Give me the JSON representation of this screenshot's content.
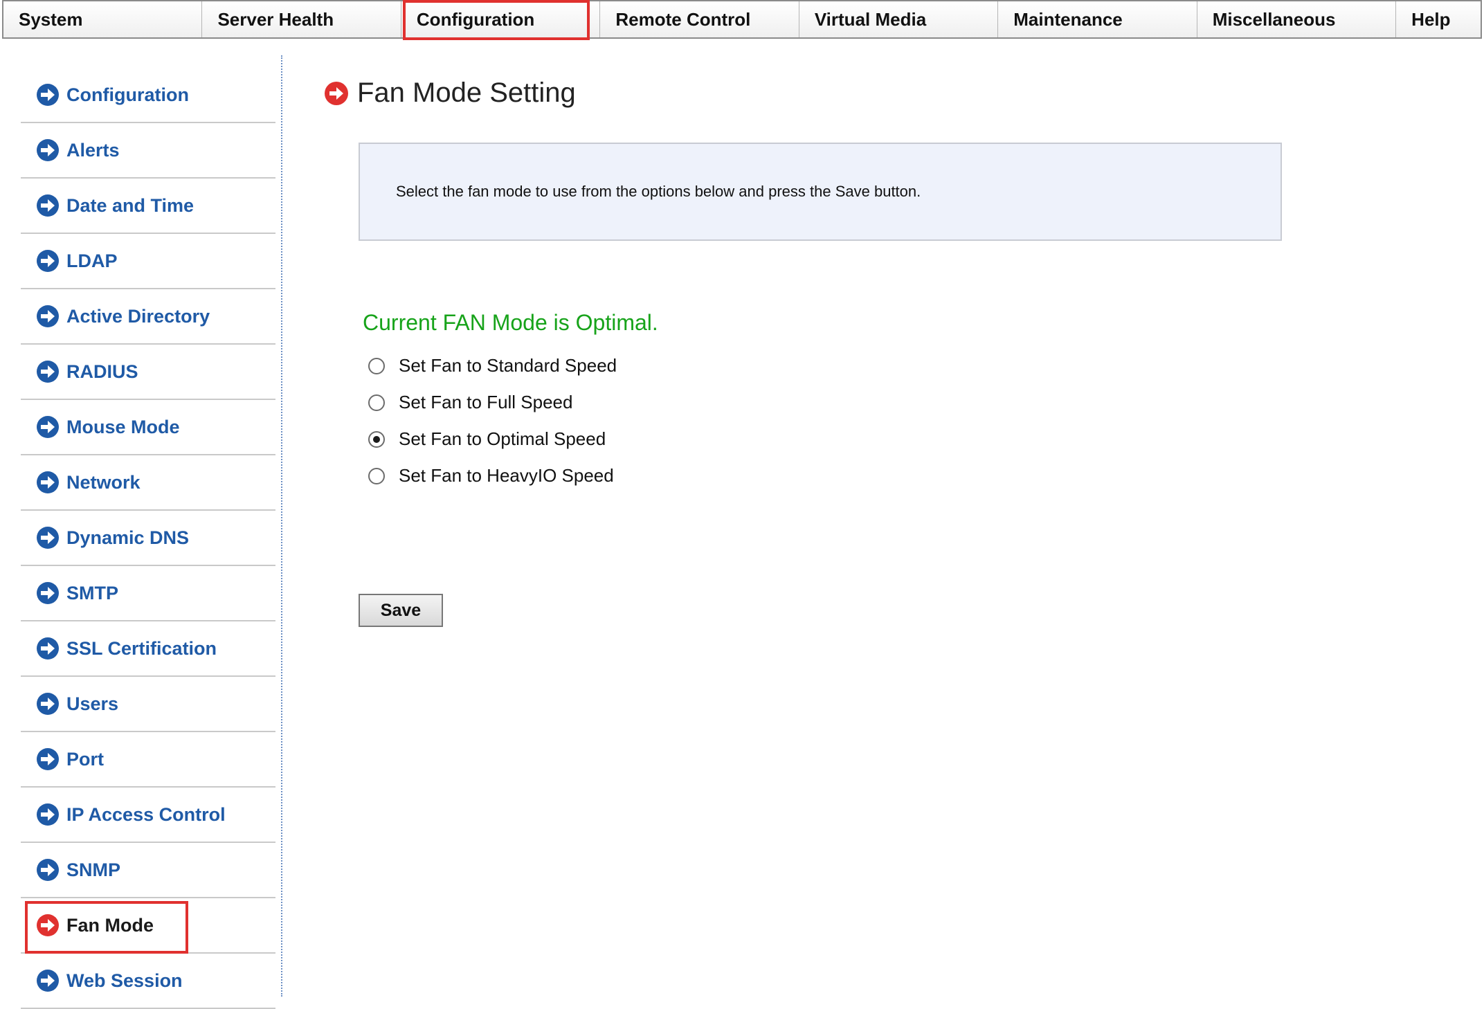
{
  "topnav": {
    "tabs": [
      {
        "label": "System",
        "width": 288
      },
      {
        "label": "Server Health",
        "width": 288
      },
      {
        "label": "Configuration",
        "width": 288,
        "highlighted": true
      },
      {
        "label": "Remote Control",
        "width": 288
      },
      {
        "label": "Virtual Media",
        "width": 288
      },
      {
        "label": "Maintenance",
        "width": 288
      },
      {
        "label": "Miscellaneous",
        "width": 288
      },
      {
        "label": "Help",
        "width": 122
      }
    ]
  },
  "sidebar": {
    "items": [
      {
        "label": "Configuration"
      },
      {
        "label": "Alerts"
      },
      {
        "label": "Date and Time"
      },
      {
        "label": "LDAP"
      },
      {
        "label": "Active Directory"
      },
      {
        "label": "RADIUS"
      },
      {
        "label": "Mouse Mode"
      },
      {
        "label": "Network"
      },
      {
        "label": "Dynamic DNS"
      },
      {
        "label": "SMTP"
      },
      {
        "label": "SSL Certification"
      },
      {
        "label": "Users"
      },
      {
        "label": "Port"
      },
      {
        "label": "IP Access Control"
      },
      {
        "label": "SNMP"
      },
      {
        "label": "Fan Mode",
        "active": true
      },
      {
        "label": "Web Session"
      }
    ]
  },
  "main": {
    "title": "Fan Mode Setting",
    "info_text": "Select the fan mode to use from the options below and press the Save button.",
    "status_text": "Current FAN Mode is Optimal.",
    "options": [
      {
        "label": "Set Fan to Standard Speed",
        "selected": false
      },
      {
        "label": "Set Fan to Full Speed",
        "selected": false
      },
      {
        "label": "Set Fan to Optimal Speed",
        "selected": true
      },
      {
        "label": "Set Fan to HeavyIO Speed",
        "selected": false
      }
    ],
    "save_label": "Save"
  },
  "colors": {
    "link_blue": "#1f5aa6",
    "active_red": "#e0312f",
    "status_green": "#17a31a",
    "info_bg": "#eef2fb"
  },
  "icons": {
    "nav_arrow": "arrow-right-circle-icon",
    "active_arrow": "arrow-right-circle-red-icon"
  }
}
